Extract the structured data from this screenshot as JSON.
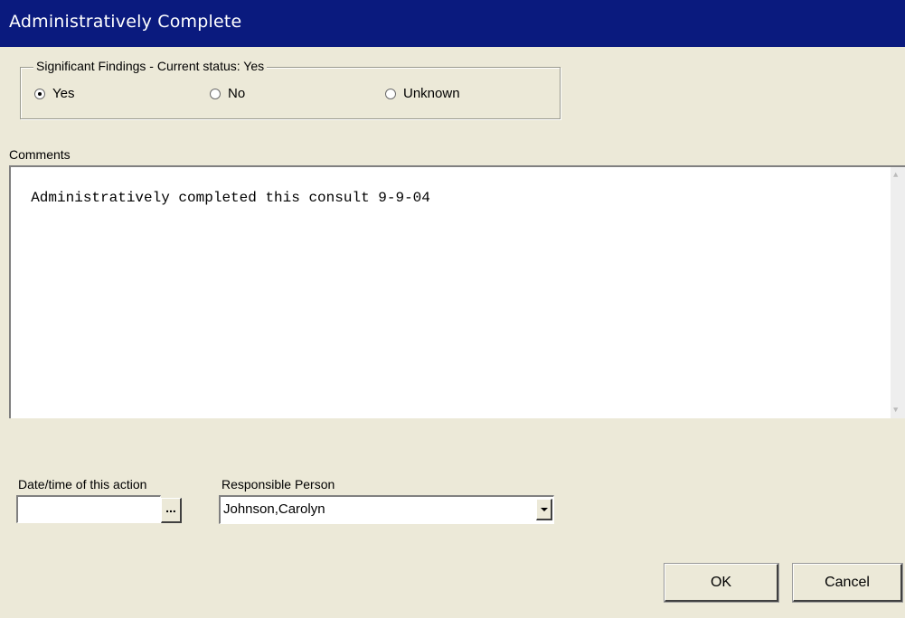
{
  "window": {
    "title": "Administratively Complete"
  },
  "findings": {
    "legend": "Significant Findings - Current status:  Yes",
    "options": [
      {
        "label": "Yes",
        "checked": true
      },
      {
        "label": "No",
        "checked": false
      },
      {
        "label": "Unknown",
        "checked": false
      }
    ]
  },
  "comments": {
    "label": "Comments",
    "text": "Administratively completed this consult 9-9-04"
  },
  "date_field": {
    "label": "Date/time of this action",
    "value": "",
    "button_label": "..."
  },
  "responsible": {
    "label": "Responsible Person",
    "value": "Johnson,Carolyn"
  },
  "buttons": {
    "ok": "OK",
    "cancel": "Cancel"
  }
}
